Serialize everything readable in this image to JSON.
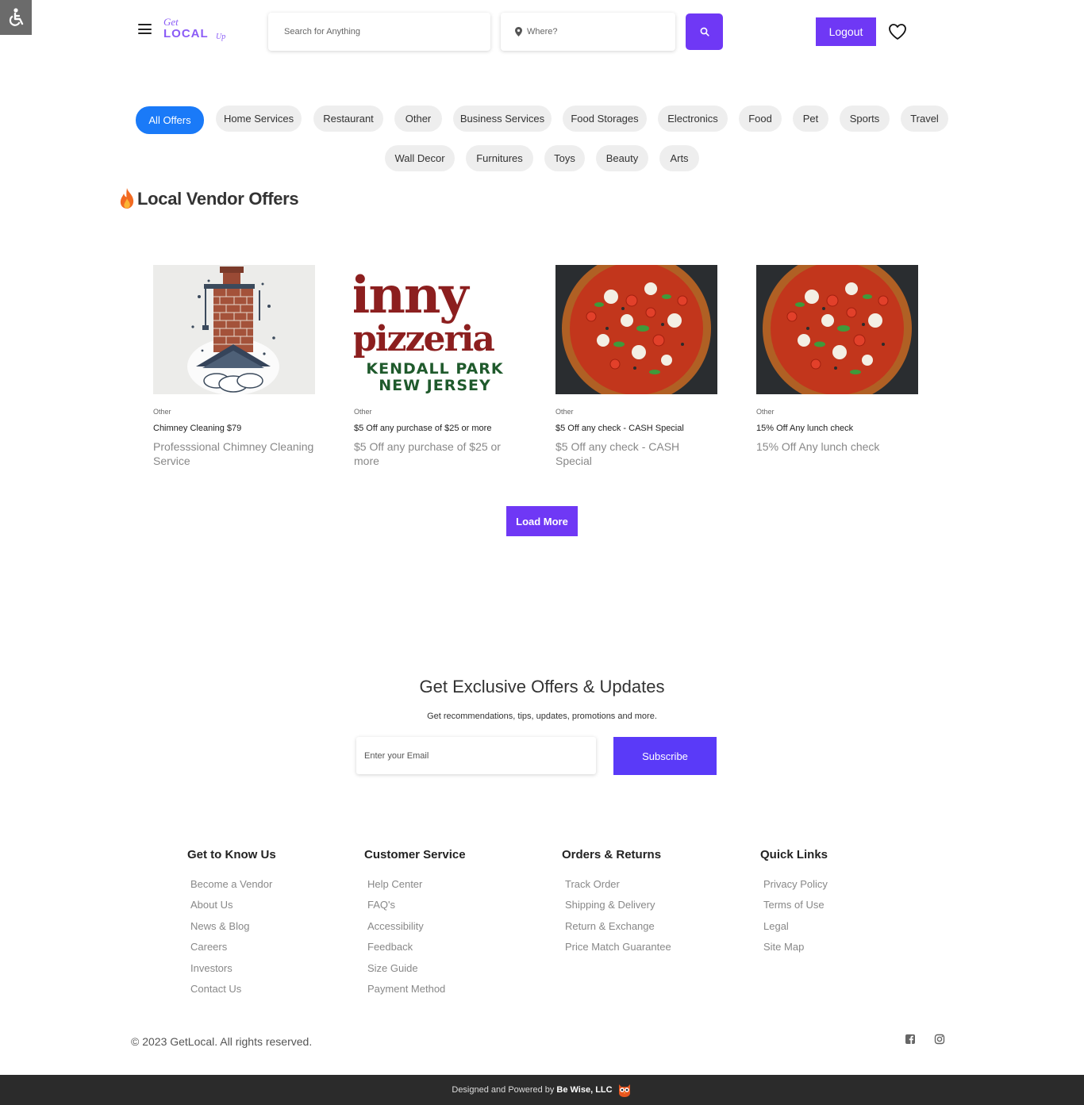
{
  "header": {
    "logo": {
      "line1": "Get",
      "line2": "LOCAL",
      "line3": "Up"
    },
    "search_placeholder": "Search for Anything",
    "location_placeholder": "Where?",
    "logout_label": "Logout"
  },
  "categories": {
    "row1": [
      "All Offers",
      "Home Services",
      "Restaurant",
      "Other",
      "Business Services",
      "Food Storages",
      "Electronics",
      "Food",
      "Pet",
      "Sports",
      "Travel"
    ],
    "row2": [
      "Wall Decor",
      "Furnitures",
      "Toys",
      "Beauty",
      "Arts"
    ],
    "active": "All Offers"
  },
  "section_title": "Local Vendor Offers",
  "offers": [
    {
      "category": "Other",
      "title": "Chimney Cleaning $79",
      "description": "Professsional Chimney Cleaning Service"
    },
    {
      "category": "Other",
      "title": "$5 Off any purchase of $25 or more",
      "description": "$5 Off any purchase of $25 or more",
      "image_text": {
        "line1": "inny",
        "line2": "pizzeria",
        "line3": "KENDALL PARK",
        "line4": "NEW JERSEY"
      }
    },
    {
      "category": "Other",
      "title": "$5 Off any check - CASH Special",
      "description": "$5 Off any check - CASH Special"
    },
    {
      "category": "Other",
      "title": "15% Off Any lunch check",
      "description": "15% Off Any lunch check"
    }
  ],
  "load_more_label": "Load More",
  "newsletter": {
    "title": "Get Exclusive Offers & Updates",
    "subtitle": "Get recommendations, tips, updates, promotions and more.",
    "email_placeholder": "Enter your Email",
    "subscribe_label": "Subscribe"
  },
  "footer": {
    "columns": [
      {
        "heading": "Get to Know Us",
        "links": [
          "Become a Vendor",
          "About Us",
          "News & Blog",
          "Careers",
          "Investors",
          "Contact Us"
        ]
      },
      {
        "heading": "Customer Service",
        "links": [
          "Help Center",
          "FAQ's",
          "Accessibility",
          "Feedback",
          "Size Guide",
          "Payment Method"
        ]
      },
      {
        "heading": "Orders & Returns",
        "links": [
          "Track Order",
          "Shipping & Delivery",
          "Return & Exchange",
          "Price Match Guarantee"
        ]
      },
      {
        "heading": "Quick Links",
        "links": [
          "Privacy Policy",
          "Terms of Use",
          "Legal",
          "Site Map"
        ]
      }
    ],
    "copyright": "© 2023 GetLocal. All rights reserved.",
    "social_icons": [
      "facebook-icon",
      "instagram-icon"
    ],
    "credit_prefix": "Designed and Powered by",
    "credit_company": "Be Wise, LLC"
  },
  "colors": {
    "primary": "#6f38f5",
    "active_chip": "#1a7af8",
    "chip_bg": "#eeeeee",
    "bottom_bar": "#2b2b2b"
  }
}
